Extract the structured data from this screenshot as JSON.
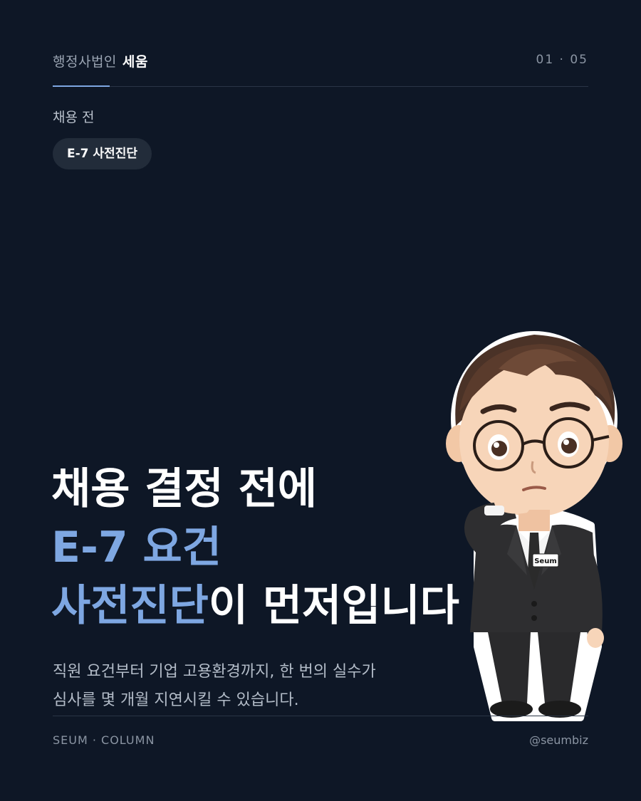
{
  "header": {
    "brand_light": "행정사법인",
    "brand_bold": "세움",
    "page_counter": "01 · 05"
  },
  "section_label": "채용 전",
  "tag": "E-7 사전진단",
  "headline": {
    "line1": "채용 결정 전에",
    "line2": "E-7 요건",
    "line3_accent": "사전진단",
    "line3_rest": "이 먼저입니다"
  },
  "subtext": {
    "line1": "직원 요건부터 기업 고용환경까지, 한 번의 실수가",
    "line2": "심사를 몇 개월 지연시킬 수 있습니다."
  },
  "footer": {
    "left": "SEUM · COLUMN",
    "right": "@seumbiz"
  },
  "character": {
    "name_badge": "Seum"
  },
  "colors": {
    "background": "#0e1726",
    "accent": "#7ea7e2",
    "pill_bg": "#222c3a"
  }
}
